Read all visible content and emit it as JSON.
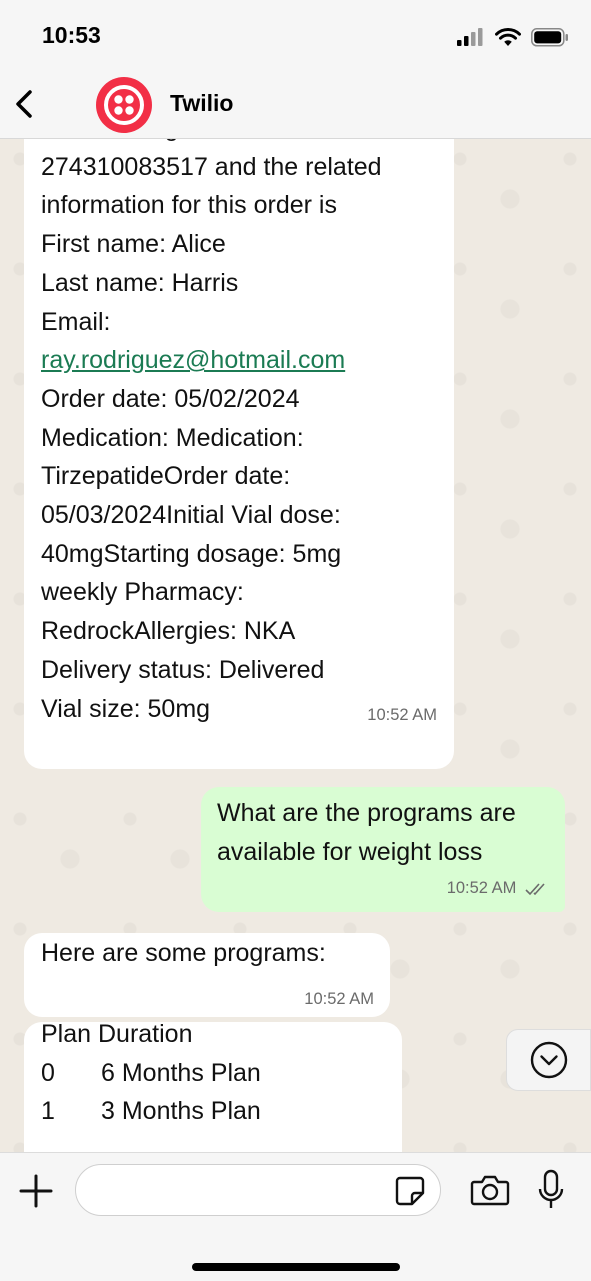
{
  "status_bar": {
    "time": "10:53"
  },
  "header": {
    "contact_name": "Twilio"
  },
  "messages": [
    {
      "direction": "incoming",
      "lines": [
        "The tracking number is:",
        "274310083517 and the related",
        "information for this order is",
        "First name: Alice",
        "Last name: Harris",
        "Email:"
      ],
      "email_link": "ray.rodriguez@hotmail.com",
      "lines_after": [
        "Order date: 05/02/2024",
        "Medication: Medication:",
        "TirzepatideOrder date:",
        "05/03/2024Initial Vial dose:",
        "40mgStarting dosage: 5mg",
        "weekly Pharmacy:",
        "RedrockAllergies: NKA",
        "Delivery status: Delivered",
        "Vial size: 50mg"
      ],
      "time": "10:52 AM"
    },
    {
      "direction": "outgoing",
      "text": "What are the programs are\navailable for weight loss",
      "time": "10:52 AM",
      "status": "read"
    },
    {
      "direction": "incoming",
      "text": "Here are some programs:",
      "time": "10:52 AM"
    },
    {
      "direction": "incoming",
      "heading": "Plan Duration",
      "rows": [
        {
          "index": "0",
          "label": "6 Months Plan"
        },
        {
          "index": "1",
          "label": "3 Months Plan"
        }
      ]
    }
  ],
  "composer": {
    "placeholder": ""
  },
  "icons": {
    "back": "chevron-left-icon",
    "scroll": "chevron-down-icon",
    "plus": "plus-icon",
    "sticker": "sticker-icon",
    "camera": "camera-icon",
    "mic": "microphone-icon"
  },
  "colors": {
    "outgoing_bubble": "#d9fdd3",
    "link": "#1b7b53",
    "twilio_red": "#f22f46"
  }
}
